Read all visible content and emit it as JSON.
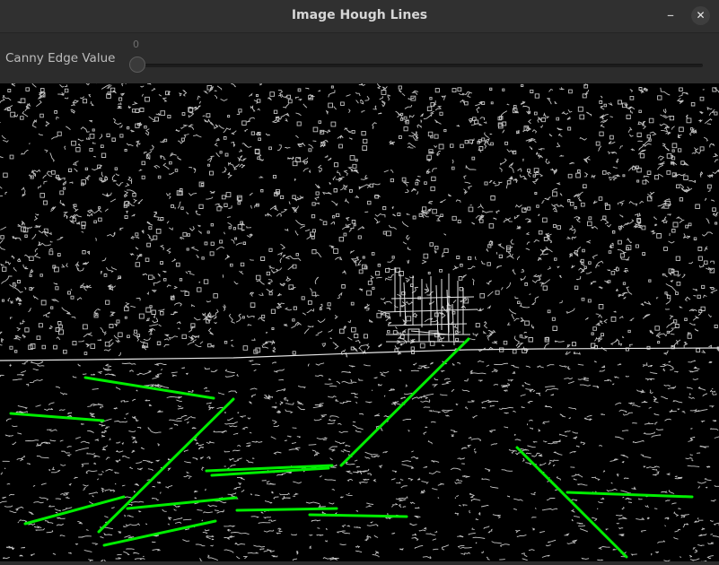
{
  "window": {
    "title": "Image Hough Lines",
    "minimize_glyph": "–",
    "close_glyph": "✕"
  },
  "trackbar": {
    "label": "Canny Edge Value",
    "value": "0"
  },
  "image": {
    "content": "canny-edge-map-with-hough-lines",
    "edge_color": "#e6e6e6",
    "line_color": "#00ff00"
  }
}
